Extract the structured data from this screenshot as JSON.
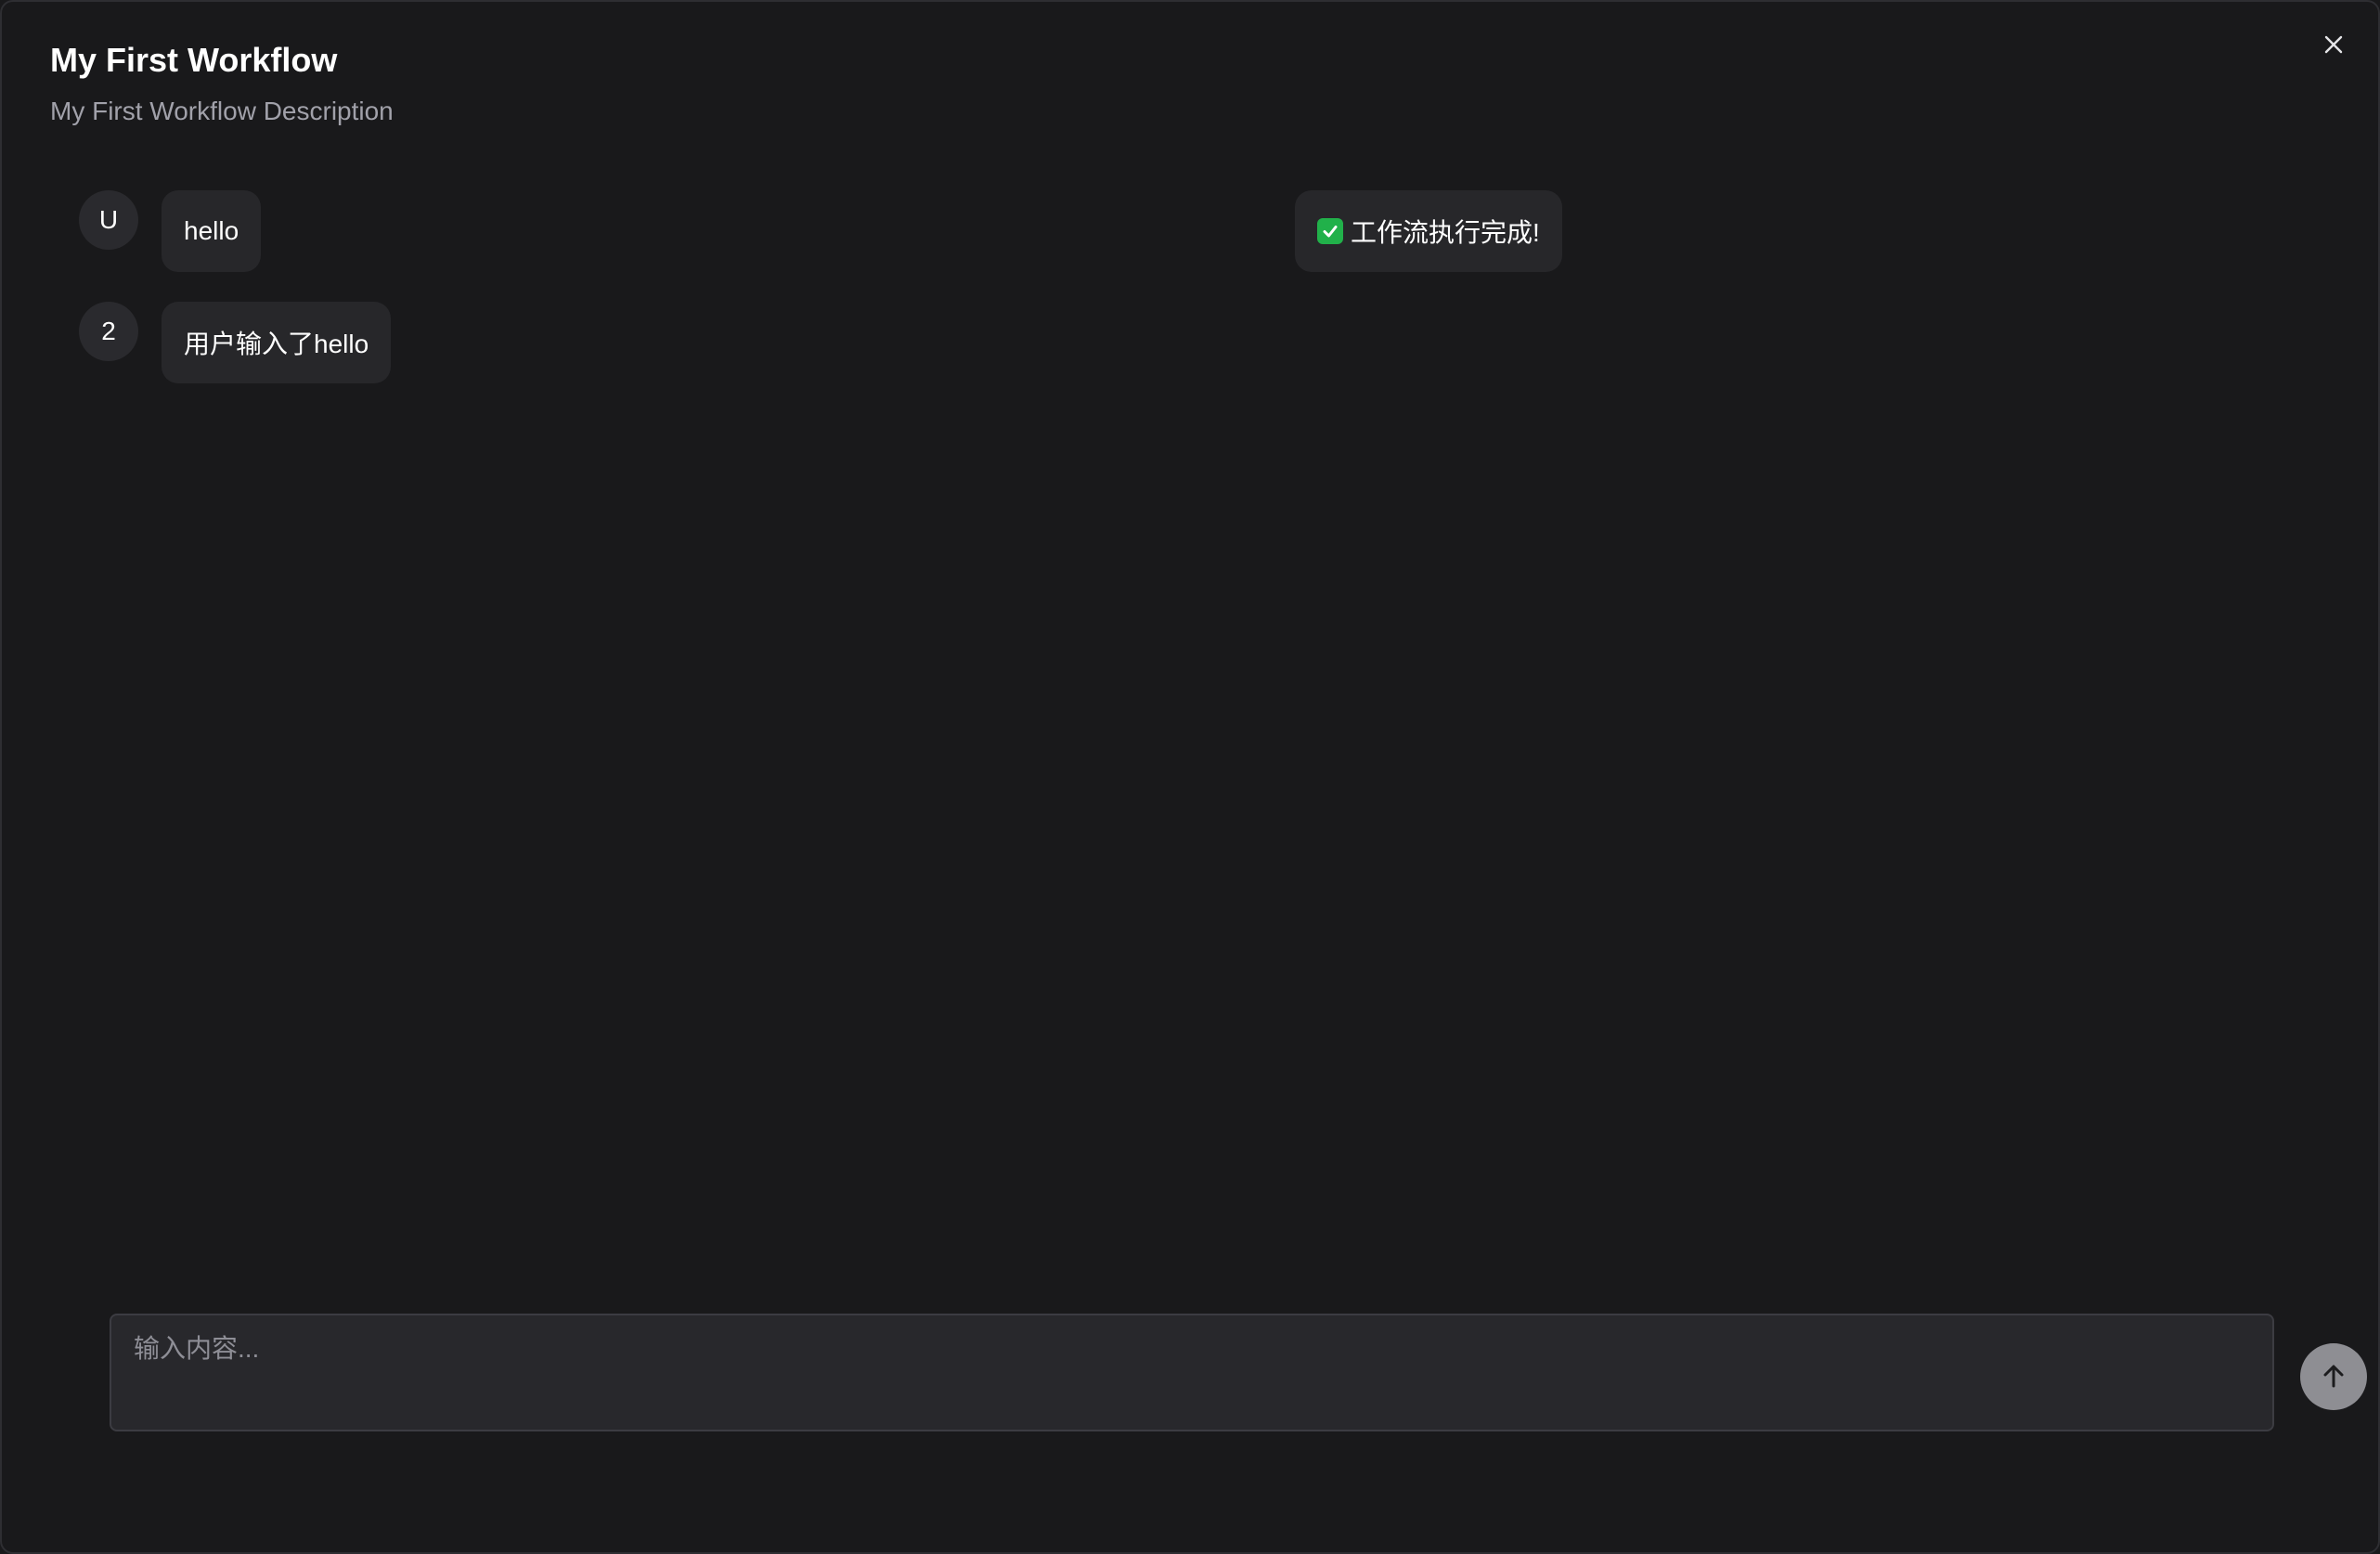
{
  "header": {
    "title": "My First Workflow",
    "description": "My First Workflow Description"
  },
  "messages": [
    {
      "avatar": "U",
      "text": "hello"
    },
    {
      "avatar": "2",
      "text": "用户输入了hello"
    }
  ],
  "status_message": {
    "icon": "check-mark-icon",
    "text": "工作流执行完成!"
  },
  "composer": {
    "placeholder": "输入内容...",
    "value": ""
  },
  "icons": {
    "close": "close-icon",
    "send": "arrow-up-icon"
  },
  "colors": {
    "background": "#19191b",
    "bubble": "#27272a",
    "success": "#21b14a",
    "send_button": "#8e8e93"
  }
}
